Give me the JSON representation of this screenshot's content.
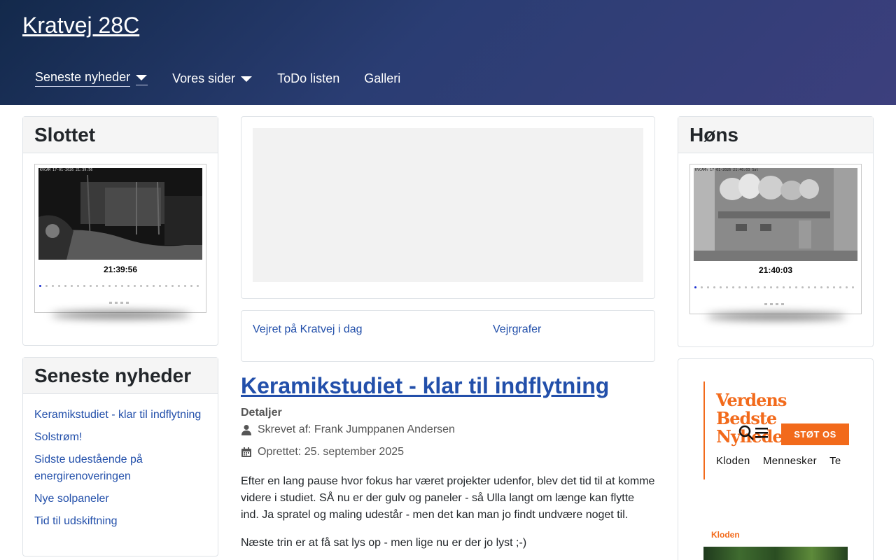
{
  "site": {
    "title": "Kratvej 28C"
  },
  "nav": {
    "items": [
      {
        "label": "Seneste nyheder",
        "has_dropdown": true,
        "active": true
      },
      {
        "label": "Vores sider",
        "has_dropdown": true,
        "active": false
      },
      {
        "label": "ToDo listen",
        "has_dropdown": false,
        "active": false
      },
      {
        "label": "Galleri",
        "has_dropdown": false,
        "active": false
      }
    ]
  },
  "left": {
    "slottet": {
      "title": "Slottet",
      "cam_time": "21:39:56",
      "cam_stamp": "KVCAM  17-01-2026 21:39:56"
    },
    "news": {
      "title": "Seneste nyheder",
      "items": [
        "Keramikstudiet - klar til indflytning",
        "Solstrøm!",
        "Sidste udestående på energirenoveringen",
        "Nye solpaneler",
        "Tid til udskiftning"
      ]
    }
  },
  "center": {
    "weather": {
      "link1": "Vejret på Kratvej i dag",
      "link2": "Vejrgrafer"
    },
    "article": {
      "title": "Keramikstudiet - klar til indflytning",
      "details_label": "Detaljer",
      "author": "Skrevet af: Frank Jumppanen Andersen",
      "created": "Oprettet: 25. september 2025",
      "paragraphs": [
        "Efter en lang pause hvor fokus har været projekter udenfor, blev det tid til at komme videre i studiet. SÅ nu er der gulv og paneler - så Ulla langt om længe kan flytte ind. Ja spratel og maling udestår - men det kan man jo findt undvære noget til.",
        "Næste trin er at få sat lys op - men lige nu er der jo lyst ;-)"
      ]
    }
  },
  "right": {
    "hons": {
      "title": "Høns",
      "cam_time": "21:40:03",
      "cam_stamp": "KVCAMh  17-01-2026 21:40:03 Sat"
    },
    "ad": {
      "logo_line1": "Verdens",
      "logo_line2": "Bedste",
      "logo_line3": "Nyheder",
      "button": "STØT OS",
      "nav_text": "Kloden Mennesker Te",
      "section_label": "Kloden"
    }
  },
  "colors": {
    "header_start": "#13294b",
    "header_end": "#3c3f7d",
    "link": "#224faa",
    "ad_accent": "#f26a1b"
  }
}
